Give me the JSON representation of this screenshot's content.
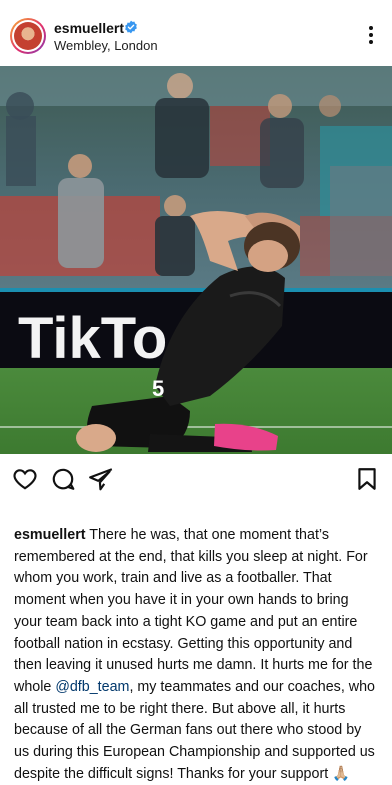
{
  "header": {
    "username": "esmuellert",
    "location": "Wembley, London"
  },
  "post": {
    "caption_user": "esmuellert",
    "caption_part1": " There he was, that one moment that’s remembered at the end, that kills you sleep at night. For whom you work, train and live as a footballer. That moment when you have it in your own hands to bring your team back into a tight KO game and put an entire football nation in ecstasy. Getting this opportunity and then leaving it unused hurts me damn. It hurts me for the whole ",
    "mention": "@dfb_team",
    "caption_part2": ", my teammates and our coaches, who all trusted me to be right there. But above all, it hurts because of all the German fans out there who stood by us during this European Championship and supported us despite the difficult signs! Thanks for your support ",
    "emoji": "🙏🏼"
  },
  "photo": {
    "board_text": "TikTo",
    "jersey_number": "5"
  },
  "colors": {
    "verified": "#3897f0",
    "mention": "#00376b"
  },
  "icons": {
    "like": "heart-icon",
    "comment": "comment-icon",
    "share": "share-icon",
    "save": "bookmark-icon",
    "more": "more-icon"
  }
}
